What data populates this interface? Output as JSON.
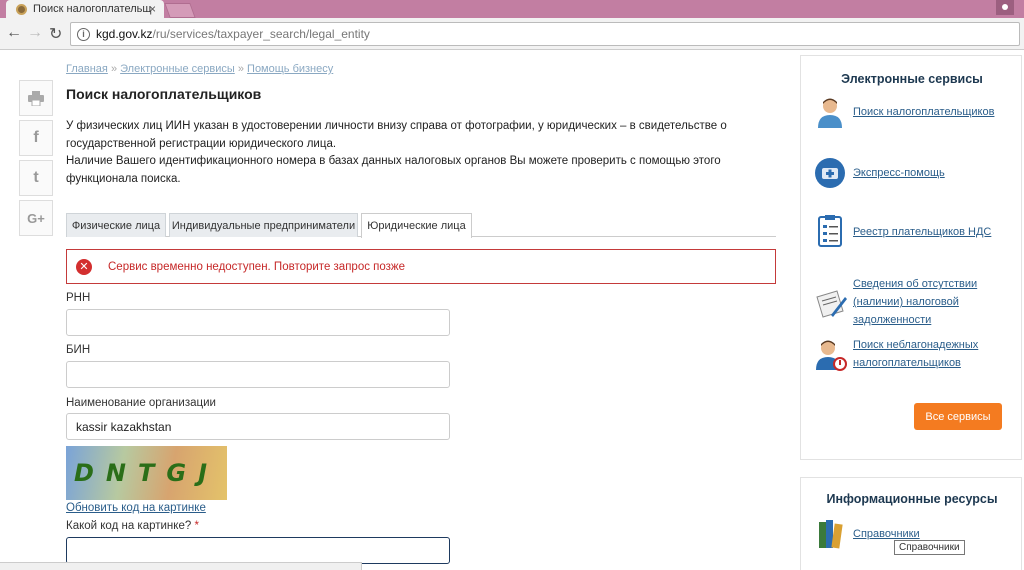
{
  "browser": {
    "tab_title": "Поиск налогоплательщ",
    "tab_close": "×",
    "url_host": "kgd.gov.kz",
    "url_path": "/ru/services/taxpayer_search/legal_entity",
    "back_glyph": "←",
    "forward_glyph": "→",
    "reload_glyph": "↻",
    "info_glyph": "i"
  },
  "share": {
    "print": "⎙",
    "facebook": "f",
    "twitter": "t",
    "gplus": "G+"
  },
  "breadcrumb": {
    "items": [
      "Главная",
      "Электронные сервисы",
      "Помощь бизнесу"
    ],
    "separator": "»"
  },
  "page": {
    "title": "Поиск налогоплательщиков",
    "intro_line1": "У физических лиц ИИН указан в удостоверении личности внизу справа от фотографии, у юридических – в свидетельстве о государственной регистрации юридического лица.",
    "intro_line2": "Наличие Вашего идентификационного номера в базах данных налоговых органов Вы можете проверить с помощью этого функционала поиска."
  },
  "tabs": [
    {
      "label": "Физические лица",
      "active": false
    },
    {
      "label": "Индивидуальные предприниматели",
      "active": false
    },
    {
      "label": "Юридические лица",
      "active": true
    }
  ],
  "error": {
    "icon": "✕",
    "text": "Сервис временно недоступен. Повторите запрос позже"
  },
  "form": {
    "rnn_label": "РНН",
    "rnn_value": "",
    "bin_label": "БИН",
    "bin_value": "",
    "org_label": "Наименование организации",
    "org_value": "kassir kazakhstan",
    "captcha_text": "DNTGJ",
    "refresh_link": "Обновить код на картинке",
    "captcha_label": "Какой код на картинке?",
    "required_mark": "*",
    "captcha_value": ""
  },
  "services": {
    "title": "Электронные сервисы",
    "items": [
      {
        "label": "Поиск налогоплательщиков",
        "icon": "user-icon"
      },
      {
        "label": "Экспресс-помощь",
        "icon": "first-aid-icon"
      },
      {
        "label": "Реестр плательщиков НДС",
        "icon": "clipboard-icon"
      },
      {
        "label": "Сведения об отсутствии (наличии) налоговой задолженности",
        "icon": "document-pen-icon"
      },
      {
        "label": "Поиск неблагонадежных налогоплательщиков",
        "icon": "user-warning-icon"
      }
    ],
    "all_button": "Все сервисы"
  },
  "resources": {
    "title": "Информационные ресурсы",
    "items": [
      {
        "label": "Справочники",
        "icon": "books-icon"
      }
    ],
    "tooltip": "Справочники"
  },
  "colors": {
    "titlebar": "#c27ea2",
    "error": "#c62828",
    "link": "#2a5d8a",
    "accent_button": "#f47b20",
    "panel_title": "#1d3850"
  }
}
